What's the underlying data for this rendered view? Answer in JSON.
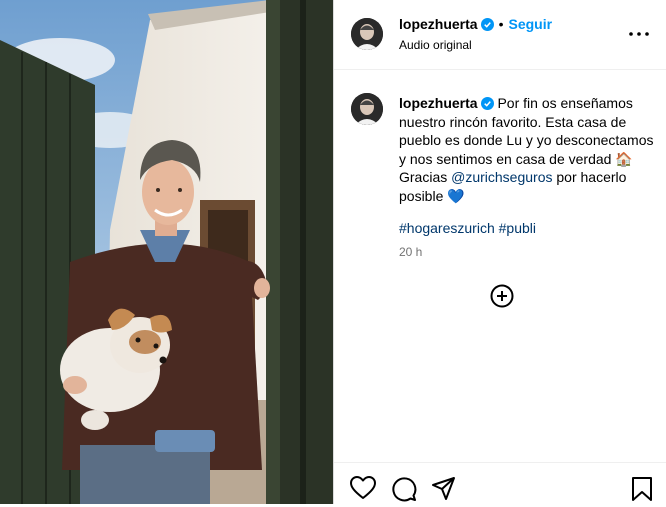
{
  "post": {
    "username": "lopezhuerta",
    "separator": "•",
    "follow_label": "Seguir",
    "audio_label": "Audio original"
  },
  "caption": {
    "username": "lopezhuerta",
    "text_part1": "Por fin os enseñamos nuestro rincón favorito. Esta casa de pueblo es donde Lu y yo desconectamos y nos sentimos en casa de verdad",
    "emoji_house": "🏠",
    "text_part2": "Gracias",
    "mention": "@zurichseguros",
    "text_part3": "por hacerlo posible",
    "emoji_heart": "💙",
    "hashtag_1": "#hogareszurich",
    "hashtag_2": "#publi",
    "timestamp": "20 h"
  },
  "icons": {
    "verified": "verified-badge-icon",
    "more": "more-options-icon",
    "add": "add-circle-icon",
    "like": "heart-icon",
    "comment": "comment-icon",
    "share": "share-icon",
    "save": "bookmark-icon"
  },
  "colors": {
    "accent": "#0095f6",
    "link": "#00376b",
    "muted": "#737373",
    "border": "#dbdbdb"
  }
}
